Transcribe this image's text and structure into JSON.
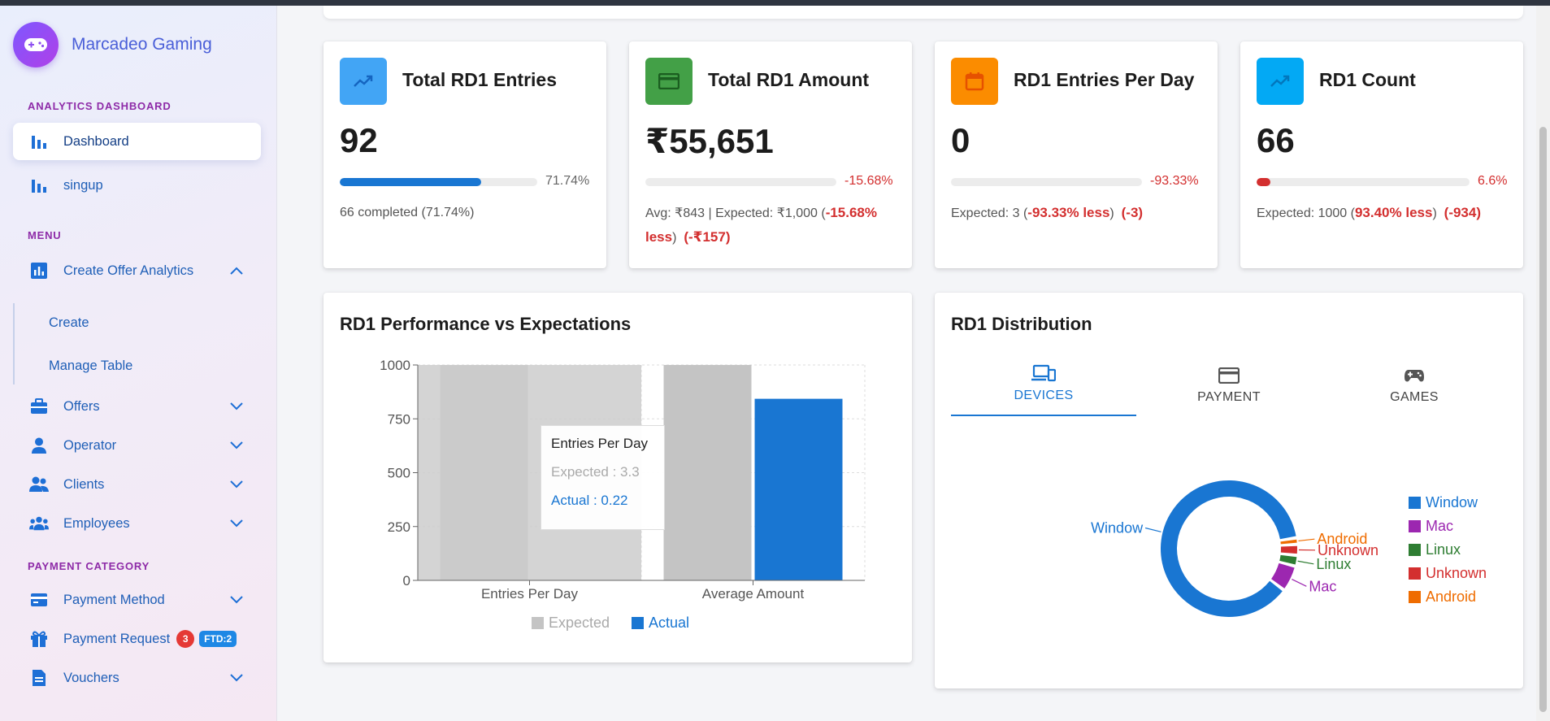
{
  "brand": {
    "name": "Marcadeo Gaming"
  },
  "sidebar": {
    "analytics_label": "ANALYTICS DASHBOARD",
    "menu_label": "MENU",
    "payment_label": "PAYMENT CATEGORY",
    "items": {
      "dashboard": "Dashboard",
      "singup": "singup",
      "create_offer_analytics": "Create Offer Analytics",
      "create": "Create",
      "manage_table": "Manage Table",
      "offers": "Offers",
      "operator": "Operator",
      "clients": "Clients",
      "employees": "Employees",
      "payment_method": "Payment Method",
      "payment_request": "Payment Request",
      "payment_request_badge": "3",
      "payment_request_ftd": "FTD:2",
      "vouchers": "Vouchers"
    }
  },
  "stats": [
    {
      "title": "Total RD1 Entries",
      "value": "92",
      "pct": "71.74%",
      "progress": 0.7174,
      "color": "#1976d2",
      "icon": "trending-up-icon",
      "note": "66 completed (71.74%)"
    },
    {
      "title": "Total RD1 Amount",
      "value": "₹55,651",
      "pct": "-15.68%",
      "progress": 0,
      "color": "#d32f2f",
      "icon": "credit-card-icon",
      "note_prefix": "Avg: ₹843 | Expected: ₹1,000 (",
      "note_neg": "-15.68% less",
      "note_close": ")",
      "note_diff": "(-₹157)"
    },
    {
      "title": "RD1 Entries Per Day",
      "value": "0",
      "pct": "-93.33%",
      "progress": 0,
      "color": "#d32f2f",
      "icon": "calendar-icon",
      "note_prefix": "Expected: 3 (",
      "note_neg": "-93.33% less",
      "note_close": ")",
      "note_diff": "(-3)"
    },
    {
      "title": "RD1 Count",
      "value": "66",
      "pct": "6.6%",
      "progress": 0.066,
      "color": "#d32f2f",
      "icon": "trending-up-icon",
      "note_prefix": "Expected: 1000 (",
      "note_neg": "93.40% less",
      "note_close": ")",
      "note_diff": "(-934)"
    }
  ],
  "performance": {
    "title": "RD1 Performance vs Expectations",
    "tooltip": {
      "title": "Entries Per Day",
      "expected": "Expected : 3.3",
      "actual": "Actual : 0.22"
    }
  },
  "distribution": {
    "title": "RD1 Distribution",
    "tabs": [
      "DEVICES",
      "PAYMENT",
      "GAMES"
    ],
    "active_tab": "DEVICES"
  },
  "chart_data": [
    {
      "type": "bar",
      "title": "RD1 Performance vs Expectations",
      "categories": [
        "Entries Per Day",
        "Average Amount"
      ],
      "series": [
        {
          "name": "Expected",
          "values": [
            1000,
            1000
          ],
          "color": "#c4c4c4"
        },
        {
          "name": "Actual",
          "values": [
            0.22,
            843
          ],
          "color": "#1976d2"
        }
      ],
      "ylim": [
        0,
        1000
      ],
      "yticks": [
        0,
        250,
        500,
        750,
        1000
      ],
      "grid": true,
      "legend": "bottom"
    },
    {
      "type": "pie",
      "title": "RD1 Distribution",
      "slices": [
        {
          "label": "Window",
          "value": 85,
          "color": "#1976d2"
        },
        {
          "label": "Mac",
          "value": 6,
          "color": "#9c27b0"
        },
        {
          "label": "Linux",
          "value": 2.5,
          "color": "#2e7d32"
        },
        {
          "label": "Unknown",
          "value": 2.5,
          "color": "#d32f2f"
        },
        {
          "label": "Android",
          "value": 1.5,
          "color": "#ef6c00"
        }
      ],
      "legend": [
        "Window",
        "Mac",
        "Linux",
        "Unknown",
        "Android"
      ],
      "legend_placement": "right"
    }
  ]
}
